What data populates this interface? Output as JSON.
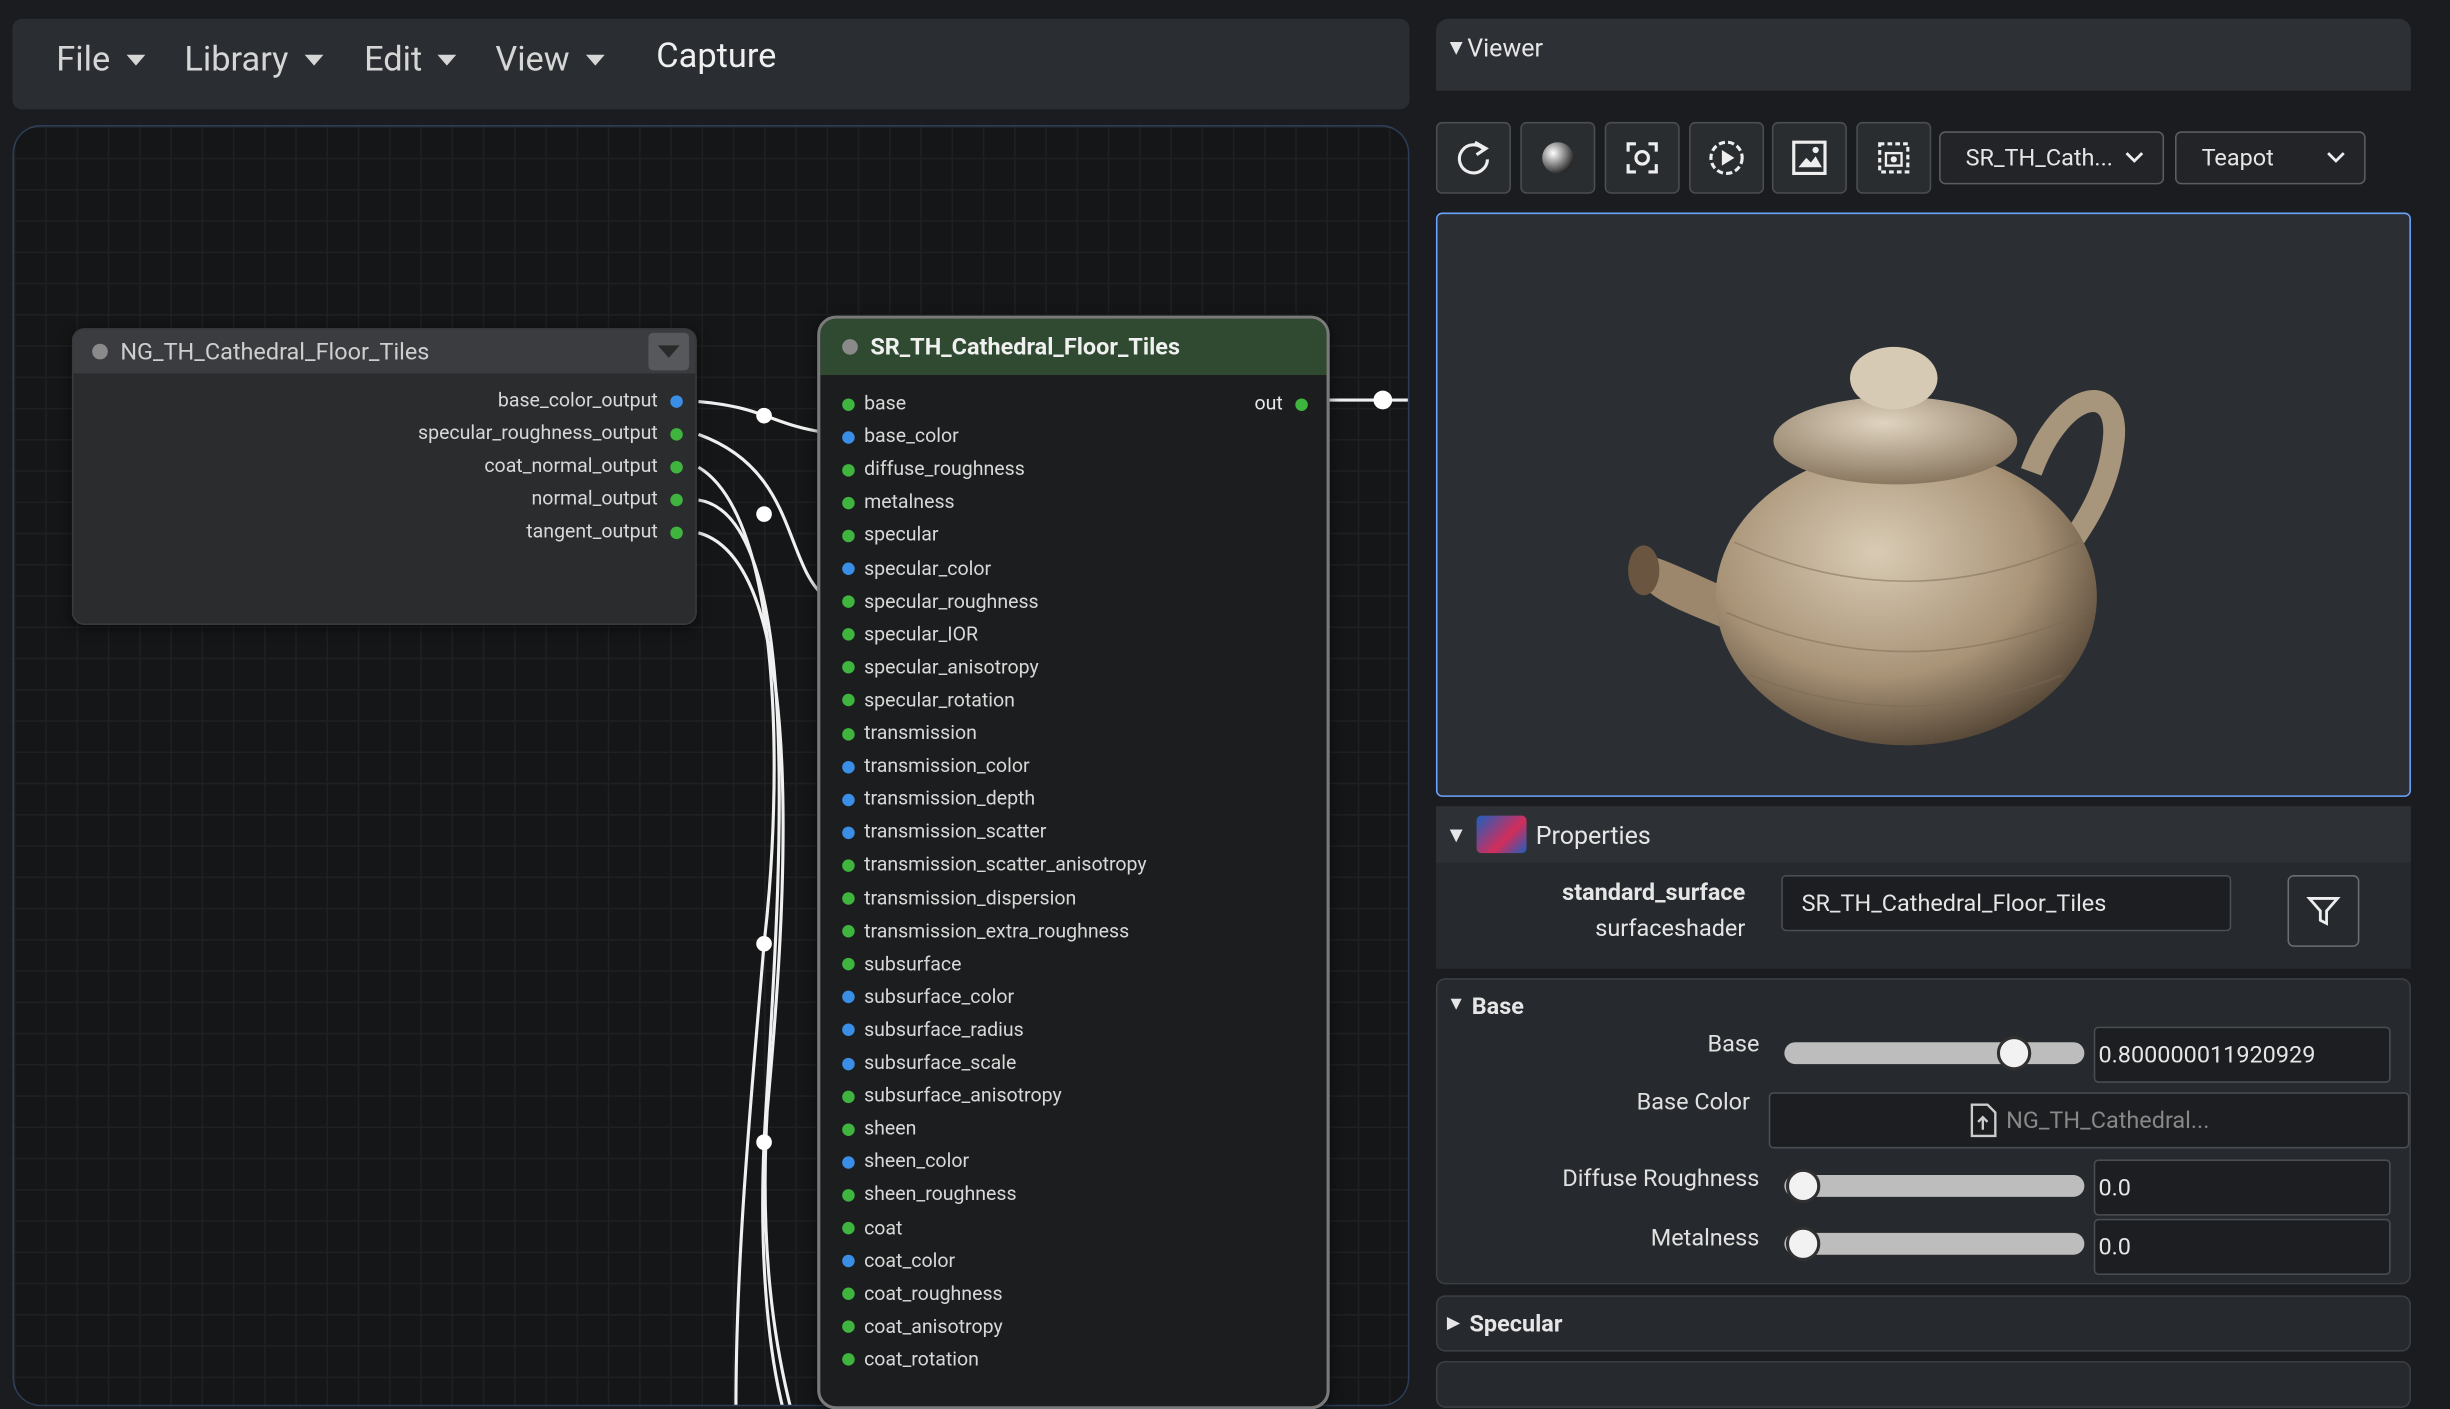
{
  "menu": {
    "file": "File",
    "library": "Library",
    "edit": "Edit",
    "view": "View",
    "capture": "Capture"
  },
  "ng_node": {
    "title": "NG_TH_Cathedral_Floor_Tiles",
    "outputs": [
      "base_color_output",
      "specular_roughness_output",
      "coat_normal_output",
      "normal_output",
      "tangent_output"
    ]
  },
  "sr_node": {
    "title": "SR_TH_Cathedral_Floor_Tiles",
    "out_label": "out",
    "inputs": [
      "base",
      "base_color",
      "diffuse_roughness",
      "metalness",
      "specular",
      "specular_color",
      "specular_roughness",
      "specular_IOR",
      "specular_anisotropy",
      "specular_rotation",
      "transmission",
      "transmission_color",
      "transmission_depth",
      "transmission_scatter",
      "transmission_scatter_anisotropy",
      "transmission_dispersion",
      "transmission_extra_roughness",
      "subsurface",
      "subsurface_color",
      "subsurface_radius",
      "subsurface_scale",
      "subsurface_anisotropy",
      "sheen",
      "sheen_color",
      "sheen_roughness",
      "coat",
      "coat_color",
      "coat_roughness",
      "coat_anisotropy",
      "coat_rotation"
    ]
  },
  "viewer": {
    "title": "Viewer",
    "material_select": "SR_TH_Cath...",
    "geometry_select": "Teapot"
  },
  "properties": {
    "title": "Properties",
    "type_name": "standard_surface",
    "type_class": "surfaceshader",
    "name_value": "SR_TH_Cathedral_Floor_Tiles"
  },
  "base_section": {
    "title": "Base",
    "base_label": "Base",
    "base_value": "0.800000011920929",
    "base_fraction": 0.8,
    "base_color_label": "Base Color",
    "base_color_value": "NG_TH_Cathedral...",
    "diffuse_label": "Diffuse Roughness",
    "diffuse_value": "0.0",
    "metalness_label": "Metalness",
    "metalness_value": "0.0"
  },
  "specular_section": {
    "title": "Specular"
  }
}
